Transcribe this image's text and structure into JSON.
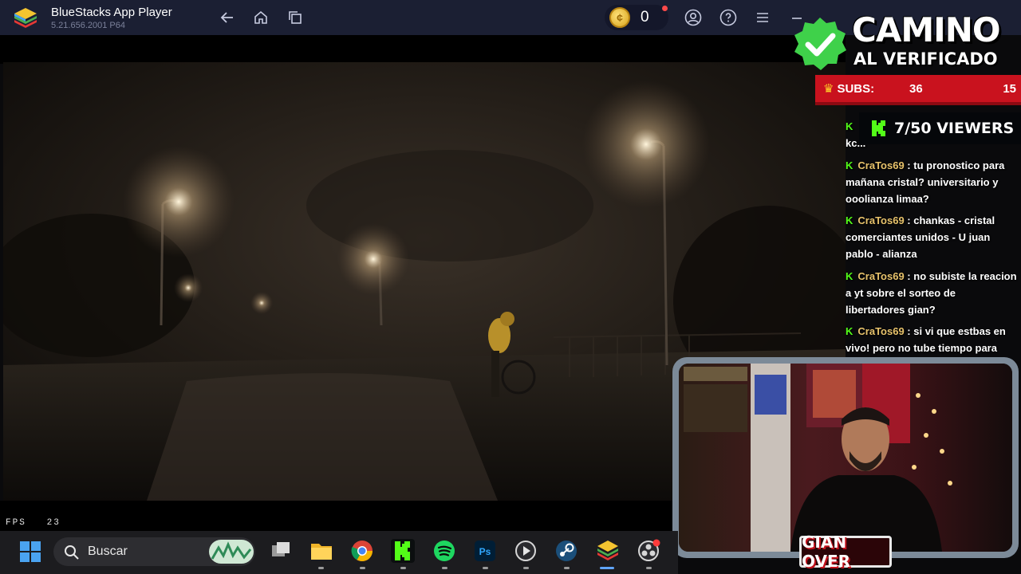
{
  "window": {
    "title": "BlueStacks App Player",
    "version": "5.21.656.2001 P64",
    "coin_count": "0"
  },
  "game": {
    "fps_label": "FPS",
    "fps_value": "23"
  },
  "overlay": {
    "camino": "CAMINO",
    "al_verificado": "AL VERIFICADO",
    "subs_label": "SUBS:",
    "subs_current": "36",
    "subs_goal": "15",
    "viewers": "7/50 VIEWERS",
    "chat": [
      {
        "user": "",
        "text": "kc..."
      },
      {
        "user": "CraTos69",
        "text": "tu pronostico para mañana cristal? universitario y ooolianza limaa?"
      },
      {
        "user": "CraTos69",
        "text": "chankas - cristal comerciantes unidos - U juan pablo - alianza"
      },
      {
        "user": "CraTos69",
        "text": "no subiste la reacion a yt sobre el sorteo de libertadores gian?"
      },
      {
        "user": "CraTos69",
        "text": "si vi que estbas en vivo! pero no tube tiempo para"
      }
    ],
    "name_plate": "GIAN OVER"
  },
  "taskbar": {
    "search_label": "Buscar",
    "apps": [
      "task-view",
      "file-explorer",
      "chrome",
      "kick",
      "spotify",
      "photoshop",
      "media-player",
      "steam",
      "bluestacks",
      "obs"
    ]
  },
  "colors": {
    "titlebar": "#1b1f33",
    "subs_bar": "#c9121e",
    "kick_green": "#53fc18",
    "chat_user": "#e7c26b"
  }
}
